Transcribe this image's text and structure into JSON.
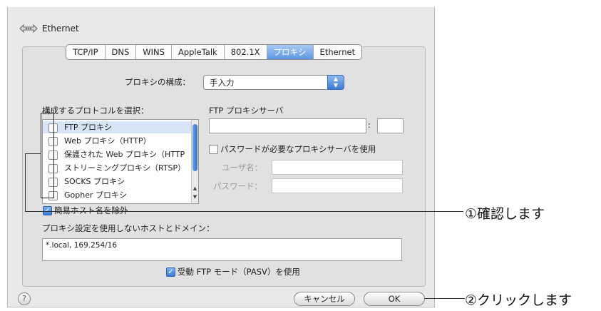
{
  "window": {
    "title": "Ethernet",
    "title_icon": "network-arrows-icon"
  },
  "tabs": [
    {
      "label": "TCP/IP",
      "active": false
    },
    {
      "label": "DNS",
      "active": false
    },
    {
      "label": "WINS",
      "active": false
    },
    {
      "label": "AppleTalk",
      "active": false
    },
    {
      "label": "802.1X",
      "active": false
    },
    {
      "label": "プロキシ",
      "active": true
    },
    {
      "label": "Ethernet",
      "active": false
    }
  ],
  "proxy_config": {
    "label": "プロキシの構成：",
    "value": "手入力"
  },
  "protocol_list": {
    "label": "構成するプロトコルを選択：",
    "items": [
      {
        "label": "FTP プロキシ",
        "checked": false
      },
      {
        "label": "Web プロキシ（HTTP）",
        "checked": false
      },
      {
        "label": "保護された Web プロキシ（HTTP",
        "checked": false
      },
      {
        "label": "ストリーミングプロキシ（RTSP）",
        "checked": false
      },
      {
        "label": "SOCKS プロキシ",
        "checked": false
      },
      {
        "label": "Gopher プロキシ",
        "checked": false
      }
    ]
  },
  "ftp_proxy": {
    "label": "FTP プロキシサーバ",
    "server_value": "",
    "colon": ":",
    "port_value": "",
    "password_required_label": "パスワードが必要なプロキシサーバを使用",
    "password_required_checked": false,
    "username_label": "ユーザ名：",
    "password_label": "パスワード："
  },
  "exclude_simple_hosts": {
    "label": "簡易ホスト名を除外",
    "checked": true
  },
  "bypass": {
    "label": "プロキシ設定を使用しないホストとドメイン：",
    "value": "*.local, 169.254/16"
  },
  "pasv": {
    "label": "受動 FTP モード（PASV）を使用",
    "checked": true
  },
  "buttons": {
    "help": "?",
    "cancel": "キャンセル",
    "ok": "OK"
  },
  "annotations": {
    "step1": "①確認します",
    "step2": "②クリックします"
  }
}
